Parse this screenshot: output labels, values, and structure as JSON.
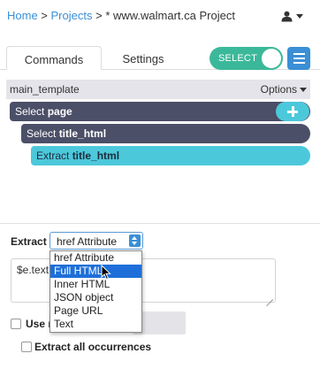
{
  "breadcrumb": {
    "home": "Home",
    "sep1": " > ",
    "projects": "Projects",
    "sep2": " > ",
    "current": "* www.walmart.ca Project"
  },
  "user_menu": {
    "icon": "user-icon"
  },
  "tabs": [
    {
      "label": "Commands",
      "active": true
    },
    {
      "label": "Settings",
      "active": false
    }
  ],
  "select_toggle": {
    "label": "SELECT",
    "on": true,
    "color": "#3bb89a"
  },
  "menu_button": {
    "icon": "hamburger-icon",
    "color": "#3a8fd6"
  },
  "template": {
    "name": "main_template",
    "options_label": "Options"
  },
  "commands": [
    {
      "verb": "Select ",
      "target": "page"
    },
    {
      "verb": "Select ",
      "target": "title_html"
    },
    {
      "verb": "Extract ",
      "target": "title_html"
    }
  ],
  "extract": {
    "label": "Extract",
    "selected": "href Attribute",
    "options": [
      "href Attribute",
      "Full HTML",
      "Inner HTML",
      "JSON object",
      "Page URL",
      "Text"
    ],
    "highlighted": "Full HTML",
    "expression": "$e.text"
  },
  "checkboxes": {
    "regex_label": "Use r",
    "all_occurrences_label": "Extract all occurrences"
  },
  "colors": {
    "command_dark": "#4b4f67",
    "command_active": "#4cc8db",
    "link": "#3a8fd6",
    "highlight": "#1e6fd9"
  }
}
